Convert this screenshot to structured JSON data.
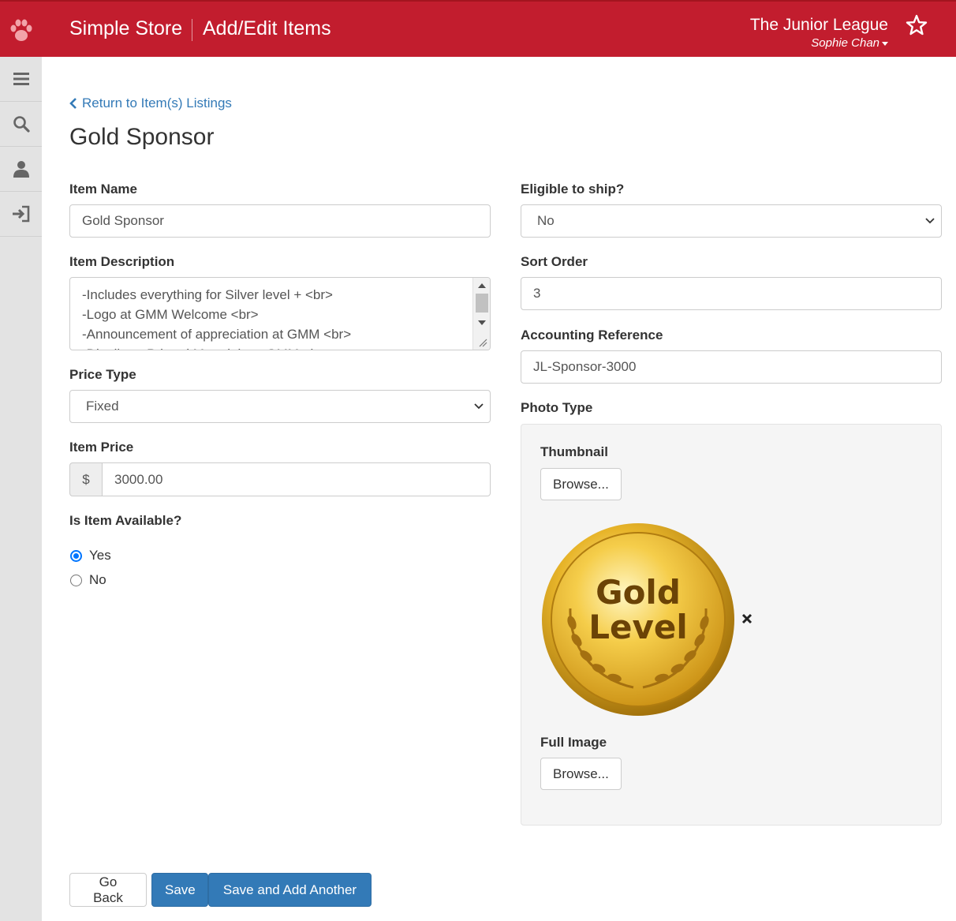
{
  "header": {
    "app_title": "Simple Store",
    "section_title": "Add/Edit Items",
    "org_name": "The Junior League",
    "user_name": "Sophie Chan",
    "brand_color": "#c21d2e"
  },
  "sidebar": {
    "items": [
      {
        "icon": "menu-icon"
      },
      {
        "icon": "search-icon"
      },
      {
        "icon": "user-icon"
      },
      {
        "icon": "sign-in-icon"
      }
    ]
  },
  "nav": {
    "back_link": "Return to Item(s) Listings"
  },
  "page_title": "Gold Sponsor",
  "form": {
    "item_name": {
      "label": "Item Name",
      "value": "Gold Sponsor"
    },
    "item_description": {
      "label": "Item Description",
      "lines": [
        "-Includes everything for Silver level + <br>",
        "-Logo at GMM Welcome <br>",
        "-Announcement of appreciation at GMM <br>",
        "-Distribute Printed Materials at GMM <br>"
      ]
    },
    "price_type": {
      "label": "Price Type",
      "value": "Fixed"
    },
    "item_price": {
      "label": "Item Price",
      "currency_symbol": "$",
      "value": "3000.00"
    },
    "availability": {
      "label": "Is Item Available?",
      "options": [
        {
          "label": "Yes",
          "selected": true
        },
        {
          "label": "No",
          "selected": false
        }
      ]
    },
    "eligible_to_ship": {
      "label": "Eligible to ship?",
      "value": "No"
    },
    "sort_order": {
      "label": "Sort Order",
      "value": "3"
    },
    "accounting_reference": {
      "label": "Accounting Reference",
      "value": "JL-Sponsor-3000"
    },
    "photo_type": {
      "label": "Photo Type",
      "thumbnail_label": "Thumbnail",
      "full_image_label": "Full Image",
      "browse_label": "Browse...",
      "thumbnail_image": {
        "line1": "Gold",
        "line2": "Level"
      }
    }
  },
  "actions": {
    "go_back": "Go Back",
    "save": "Save",
    "save_add_another": "Save and Add Another",
    "primary_color": "#337ab7"
  }
}
